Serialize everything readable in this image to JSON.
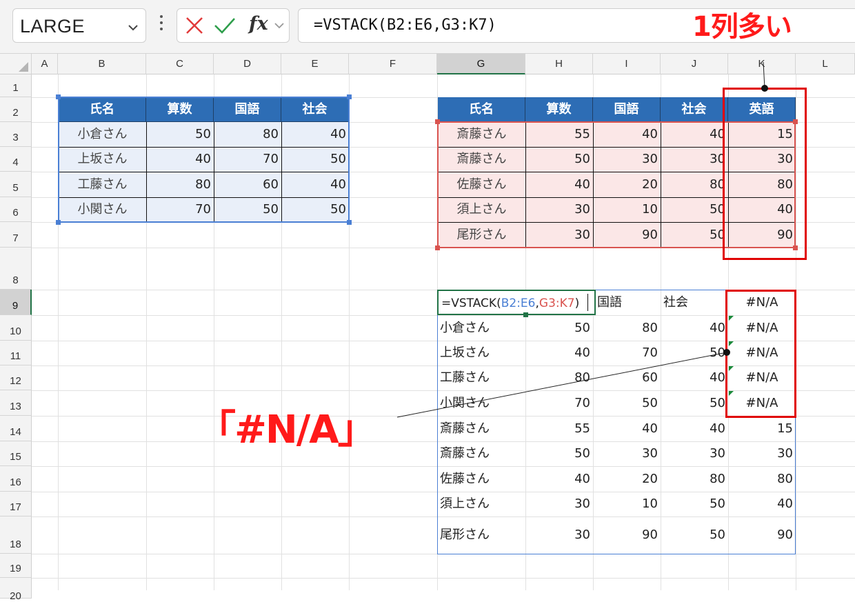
{
  "formula_bar": {
    "name_box": "LARGE",
    "fx_label": "fx",
    "formula": "=VSTACK(B2:E6,G3:K7)"
  },
  "columns": [
    "A",
    "B",
    "C",
    "D",
    "E",
    "F",
    "G",
    "H",
    "I",
    "J",
    "K",
    "L"
  ],
  "rows": [
    "1",
    "2",
    "3",
    "4",
    "5",
    "6",
    "7",
    "8",
    "9",
    "10",
    "11",
    "12",
    "13",
    "14",
    "15",
    "16",
    "17",
    "18",
    "19",
    "20"
  ],
  "table1": {
    "headers": [
      "氏名",
      "算数",
      "国語",
      "社会"
    ],
    "rows": [
      [
        "小倉さん",
        "50",
        "80",
        "40"
      ],
      [
        "上坂さん",
        "40",
        "70",
        "50"
      ],
      [
        "工藤さん",
        "80",
        "60",
        "40"
      ],
      [
        "小関さん",
        "70",
        "50",
        "50"
      ]
    ]
  },
  "table2": {
    "headers": [
      "氏名",
      "算数",
      "国語",
      "社会",
      "英語"
    ],
    "rows": [
      [
        "斎藤さん",
        "55",
        "40",
        "40",
        "15"
      ],
      [
        "斎藤さん",
        "50",
        "30",
        "30",
        "30"
      ],
      [
        "佐藤さん",
        "40",
        "20",
        "80",
        "80"
      ],
      [
        "須上さん",
        "30",
        "10",
        "50",
        "40"
      ],
      [
        "尾形さん",
        "30",
        "90",
        "50",
        "90"
      ]
    ]
  },
  "result": {
    "formula_prefix": "=VSTACK(",
    "formula_ref1": "B2:E6",
    "formula_sep": ",",
    "formula_ref2": "G3:K7",
    "formula_suffix": ")",
    "header_rest": [
      "国語",
      "社会"
    ],
    "error": "#N/A",
    "rows": [
      [
        "小倉さん",
        "50",
        "80",
        "40",
        "#N/A"
      ],
      [
        "上坂さん",
        "40",
        "70",
        "50",
        "#N/A"
      ],
      [
        "工藤さん",
        "80",
        "60",
        "40",
        "#N/A"
      ],
      [
        "小関さん",
        "70",
        "50",
        "50",
        "#N/A"
      ],
      [
        "斎藤さん",
        "55",
        "40",
        "40",
        "15"
      ],
      [
        "斎藤さん",
        "50",
        "30",
        "30",
        "30"
      ],
      [
        "佐藤さん",
        "40",
        "20",
        "80",
        "80"
      ],
      [
        "須上さん",
        "30",
        "10",
        "50",
        "40"
      ],
      [
        "尾形さん",
        "30",
        "90",
        "50",
        "90"
      ]
    ]
  },
  "annotations": {
    "one_more_column": "1列多い",
    "na_label": "「#N/A」"
  },
  "colors": {
    "header_blue": "#2d6db5",
    "table1_fill": "#e9eff9",
    "table2_fill": "#fbe7e7",
    "ref_blue": "#4a7fd4",
    "ref_red": "#d9534f",
    "annotation_red": "#ff1a1a",
    "excel_green": "#217346"
  }
}
